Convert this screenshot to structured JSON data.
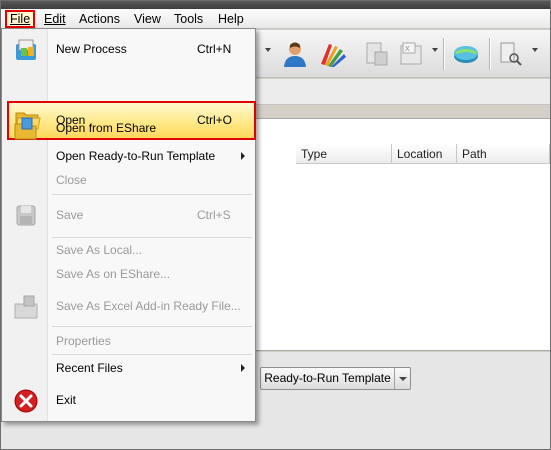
{
  "menubar": {
    "items": [
      {
        "label": "File",
        "active": true
      },
      {
        "label": "Edit"
      },
      {
        "label": "Actions"
      },
      {
        "label": "View"
      },
      {
        "label": "Tools"
      },
      {
        "label": "Help"
      }
    ]
  },
  "table": {
    "columns": [
      "Type",
      "Location",
      "Path"
    ]
  },
  "bottom": {
    "template_button": "Ready-to-Run Template"
  },
  "file_menu": {
    "items": [
      {
        "label": "New Process",
        "shortcut": "Ctrl+N",
        "icon": "new-process-icon"
      },
      {
        "label": "Open",
        "shortcut": "Ctrl+O",
        "icon": "folder-open-icon",
        "highlighted": true
      },
      {
        "label": "Open from EShare",
        "icon": "eshare-open-icon"
      },
      {
        "label": "Open Ready-to-Run Template",
        "submenu": true
      },
      {
        "label": "Close",
        "disabled": true
      },
      {
        "label": "Save",
        "shortcut": "Ctrl+S",
        "disabled": true,
        "icon": "save-icon"
      },
      {
        "label": "Save As Local...",
        "disabled": true
      },
      {
        "label": "Save As on EShare...",
        "disabled": true
      },
      {
        "label": "Save As Excel Add-in Ready File...",
        "disabled": true,
        "icon": "excel-addin-icon"
      },
      {
        "label": "Properties",
        "disabled": true
      },
      {
        "label": "Recent Files",
        "submenu": true
      },
      {
        "label": "Exit",
        "icon": "exit-icon"
      }
    ]
  },
  "colors": {
    "highlight_border": "#e00000",
    "highlight_fill": "#ffe98a",
    "disabled_text": "#9a9a9a"
  }
}
